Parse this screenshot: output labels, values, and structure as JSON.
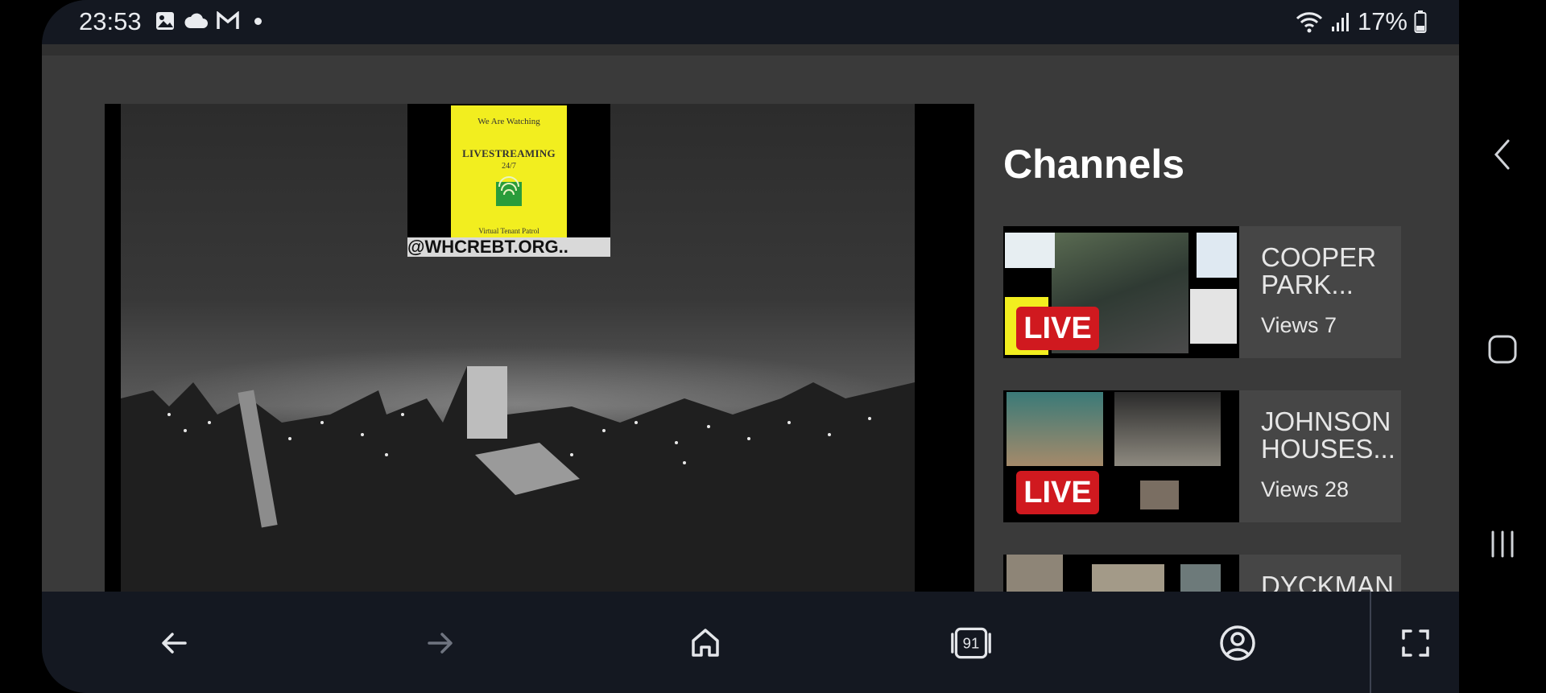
{
  "status": {
    "time": "23:53",
    "battery": "17%",
    "left_icons": [
      "gallery-icon",
      "cloud-icon",
      "gmail-icon",
      "notification-dot-icon"
    ],
    "right_icons": [
      "wifi-icon",
      "signal-icon",
      "battery-icon"
    ]
  },
  "video": {
    "sign_line1": "We Are Watching",
    "sign_line2": "LIVESTREAMING",
    "sign_line3": "24/7",
    "sign_line4": "Virtual Tenant Patrol",
    "url": "@WHCREBT.ORG.."
  },
  "channels": {
    "title": "Channels",
    "items": [
      {
        "name": "COOPER PARK...",
        "views": "Views 7",
        "badge": "LIVE"
      },
      {
        "name": "JOHNSON HOUSES...",
        "views": "Views 28",
        "badge": "LIVE"
      },
      {
        "name": "DYCKMAN",
        "views": "",
        "badge": ""
      }
    ]
  },
  "bottom_nav": {
    "tab_count": "91",
    "icons": [
      "back-icon",
      "forward-icon",
      "home-icon",
      "tabs-icon",
      "profile-icon",
      "fullscreen-icon"
    ]
  },
  "colors": {
    "live_badge": "#d0191f",
    "panel_bg": "#3a3a3a",
    "card_bg": "#464646",
    "nav_bg": "#141821"
  }
}
